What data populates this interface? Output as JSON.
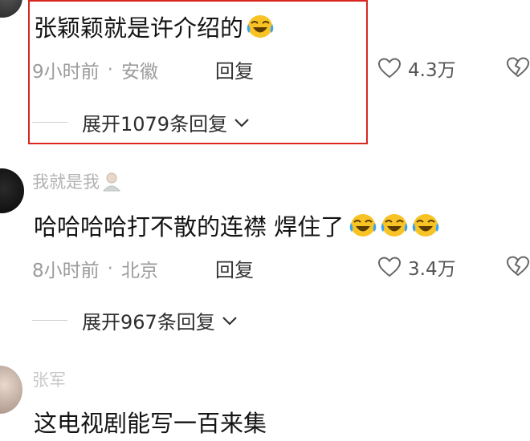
{
  "comments": [
    {
      "text": "张颖颖就是许介绍的",
      "emoji": "laughing-crying-emoji",
      "time": "9小时前",
      "location": "安徽",
      "reply_label": "回复",
      "likes": "4.3万",
      "expand_label": "展开1079条回复"
    },
    {
      "username": "我就是我",
      "text": "哈哈哈哈打不散的连襟 焊住了",
      "emoji_count": 3,
      "time": "8小时前",
      "location": "北京",
      "reply_label": "回复",
      "likes": "3.4万",
      "expand_label": "展开967条回复"
    },
    {
      "username": "张军",
      "text": "这电视剧能写一百来集"
    }
  ],
  "colors": {
    "highlight_border": "#d9271f",
    "meta_gray": "#9b9b9b",
    "emoji_yellow": "#f7c325",
    "tear_blue": "#3da4f2"
  },
  "icons": [
    "heart-outline-icon",
    "broken-heart-icon",
    "chevron-down-icon",
    "laughing-crying-emoji",
    "user-emoji"
  ]
}
